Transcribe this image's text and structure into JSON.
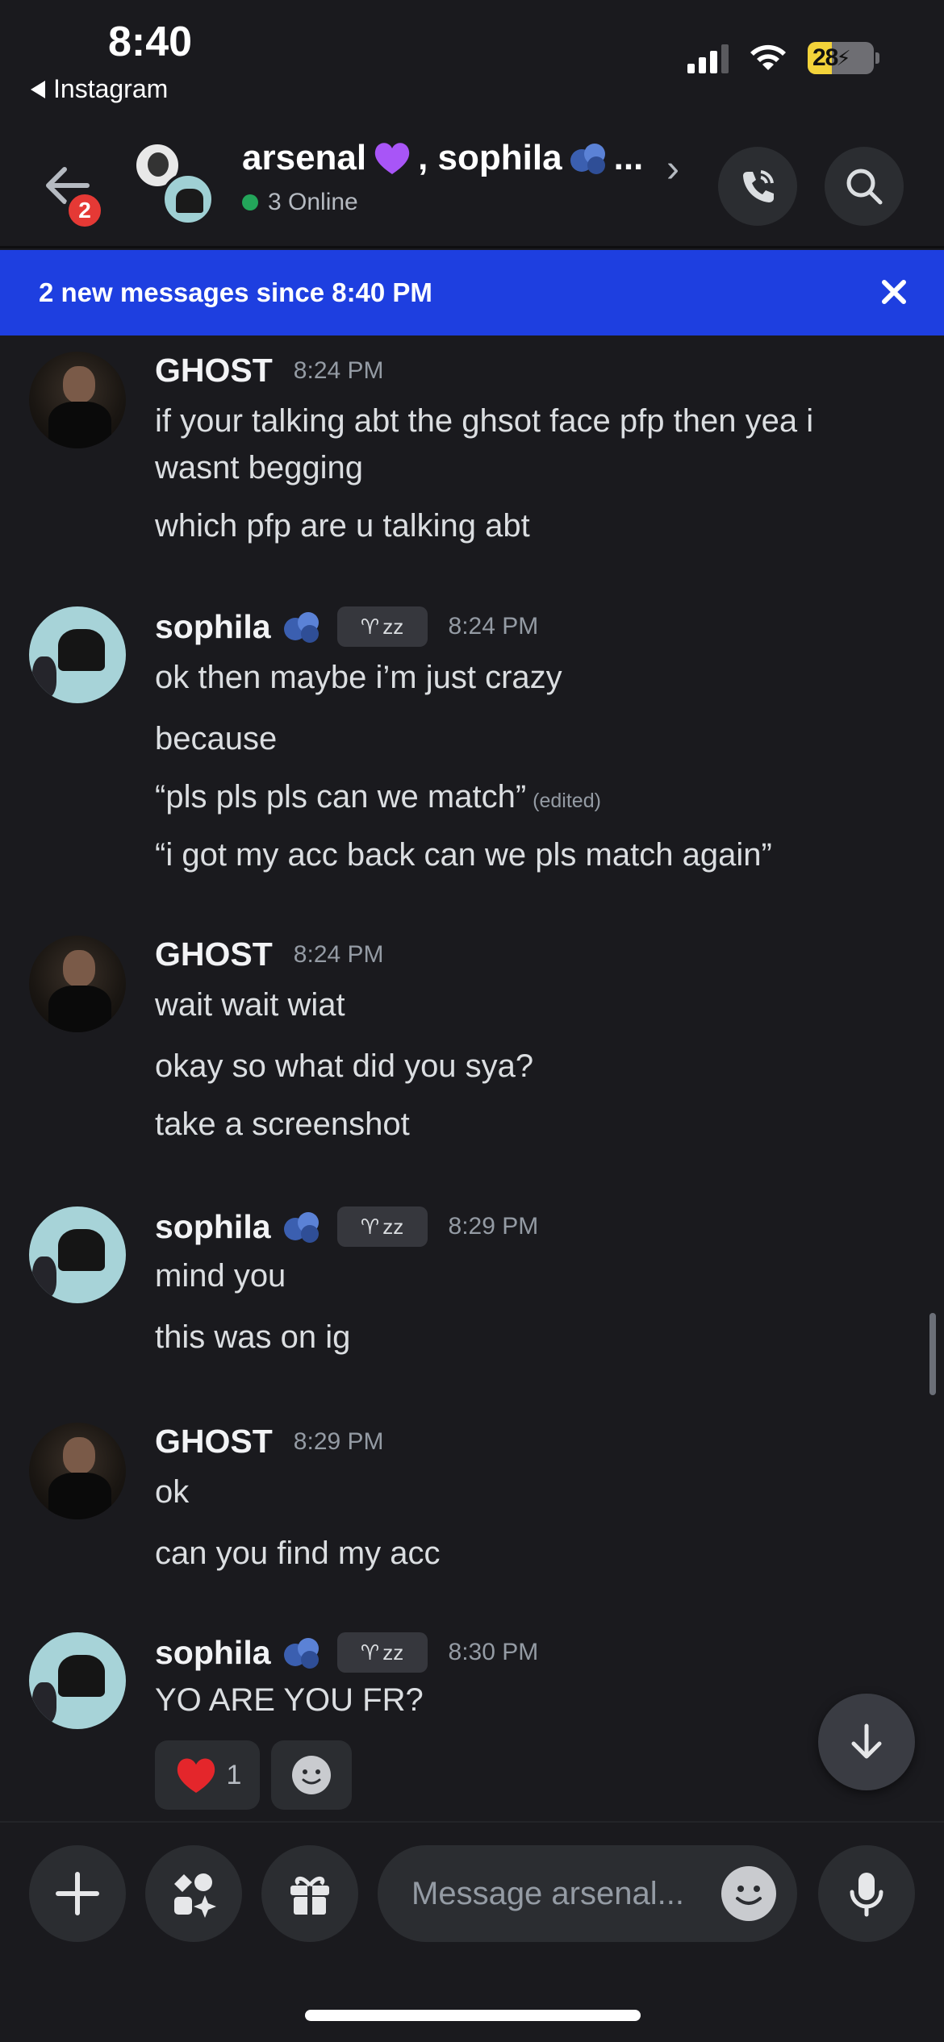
{
  "status_bar": {
    "time": "8:40",
    "back_app": "Instagram",
    "battery": "28"
  },
  "header": {
    "back_badge": "2",
    "channel_title_part1": "arsenal",
    "channel_title_part2": ", sophila",
    "channel_title_ellipsis": "...",
    "online_text": "3 Online"
  },
  "new_messages_bar": {
    "text": "2 new messages since 8:40 PM"
  },
  "messages": [
    {
      "author": "GHOST",
      "time": "8:24 PM",
      "lines": [
        "if your talking abt the ghsot face pfp then yea i",
        "wasnt begging",
        "which pfp are u talking abt"
      ]
    },
    {
      "author": "sophila",
      "tag": "zz",
      "time": "8:24 PM",
      "lines": [
        "ok then maybe i’m just crazy",
        "because",
        "“pls pls pls can we match”",
        "“i got my acc back can we pls match again”"
      ],
      "edited": "(edited)"
    },
    {
      "author": "GHOST",
      "time": "8:24 PM",
      "lines": [
        "wait wait wiat",
        "okay so what did you sya?",
        "take a screenshot"
      ]
    },
    {
      "author": "sophila",
      "tag": "zz",
      "time": "8:29 PM",
      "lines": [
        "mind you",
        "this was on ig"
      ]
    },
    {
      "author": "GHOST",
      "time": "8:29 PM",
      "lines": [
        "ok",
        "can you find my acc"
      ]
    },
    {
      "author": "sophila",
      "tag": "zz",
      "time": "8:30 PM",
      "lines": [
        "YO ARE YOU FR?"
      ],
      "reaction_count": "1"
    }
  ],
  "composer": {
    "placeholder": "Message arsenal..."
  },
  "colors": {
    "background": "#1a1a1e",
    "banner": "#1e3fe0",
    "online": "#23a55a",
    "badge": "#e53935"
  }
}
